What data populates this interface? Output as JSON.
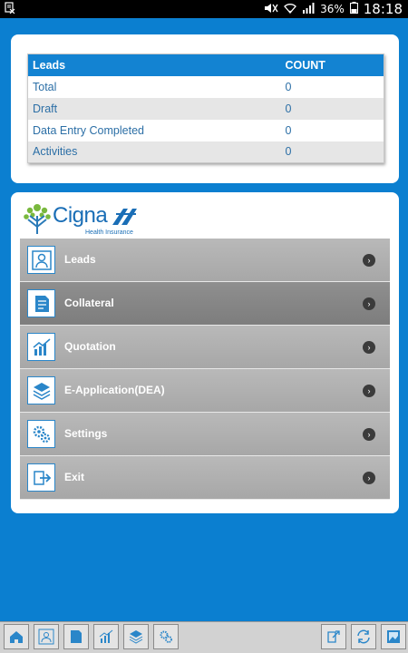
{
  "status_bar": {
    "battery": "36%",
    "time": "18:18"
  },
  "leads_table": {
    "headers": [
      "Leads",
      "COUNT"
    ],
    "rows": [
      {
        "label": "Total",
        "count": "0"
      },
      {
        "label": "Draft",
        "count": "0"
      },
      {
        "label": "Data Entry Completed",
        "count": "0"
      },
      {
        "label": "Activities",
        "count": "0"
      }
    ]
  },
  "brand": {
    "name": "Cigna",
    "tagline": "Health Insurance"
  },
  "menu": {
    "items": [
      {
        "label": "Leads",
        "icon": "person-icon"
      },
      {
        "label": "Collateral",
        "icon": "document-icon"
      },
      {
        "label": "Quotation",
        "icon": "chart-icon"
      },
      {
        "label": "E-Application(DEA)",
        "icon": "layers-icon"
      },
      {
        "label": "Settings",
        "icon": "gears-icon"
      },
      {
        "label": "Exit",
        "icon": "exit-icon"
      }
    ],
    "active_index": 1
  },
  "bottom_bar": {
    "buttons": [
      "home-icon",
      "person-icon",
      "document-icon",
      "chart-icon",
      "layers-icon",
      "gears-icon",
      "export-icon",
      "sync-icon",
      "gallery-icon"
    ]
  }
}
